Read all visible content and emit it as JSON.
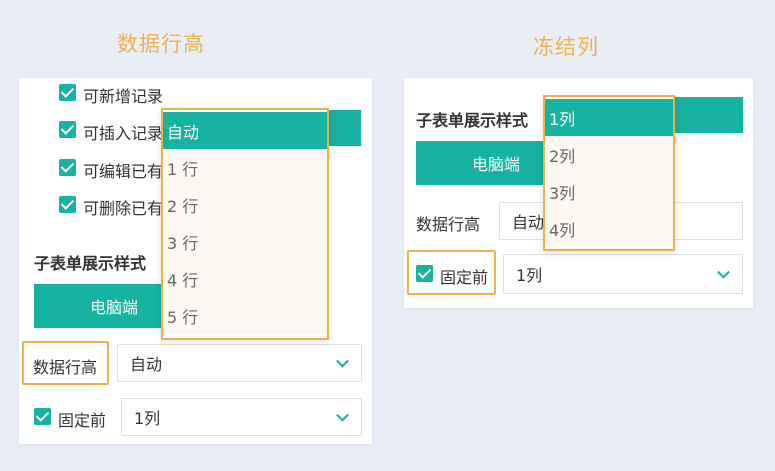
{
  "captions": {
    "left": "数据行高",
    "right": "冻结列"
  },
  "left_panel": {
    "permissions": [
      "可新增记录",
      "可插入记录",
      "可编辑已有",
      "可删除已有"
    ],
    "subtable_style_label": "子表单展示样式",
    "device_button": "电脑端",
    "row_height_label": "数据行高",
    "row_height_value": "自动",
    "freeze_label": "固定前",
    "freeze_value": "1列",
    "row_height_options": [
      "自动",
      "1 行",
      "2 行",
      "3 行",
      "4 行",
      "5 行"
    ]
  },
  "right_panel": {
    "subtable_style_label": "子表单展示样式",
    "device_button": "电脑端",
    "row_height_label": "数据行高",
    "row_height_value": "自动",
    "freeze_label": "固定前",
    "freeze_value": "1列",
    "freeze_options": [
      "1列",
      "2列",
      "3列",
      "4列"
    ]
  },
  "colors": {
    "accent": "#16b3a2",
    "highlight": "#f0b04e",
    "background": "#e9eef7"
  }
}
